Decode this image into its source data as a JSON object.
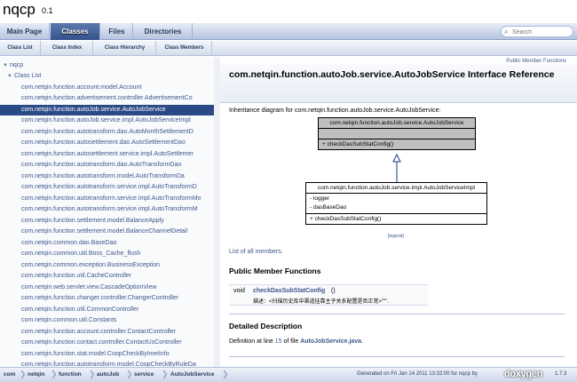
{
  "project": {
    "name": "nqcp",
    "number": "0.1"
  },
  "tabs": [
    "Main Page",
    "Classes",
    "Files",
    "Directories"
  ],
  "search": {
    "placeholder": "Search"
  },
  "subtabs": [
    "Class List",
    "Class Index",
    "Class Hierarchy",
    "Class Members"
  ],
  "nav": {
    "root": "nqcp",
    "section": "Class List",
    "items": [
      "com.netqin.function.account.model.Account",
      "com.netqin.function.advertisement.controller.AdvertisementCo",
      "com.netqin.function.autoJob.service.AutoJobService",
      "com.netqin.function.autoJob.service.impl.AutoJobServiceImpl",
      "com.netqin.function.autotransform.dao.AutoMonthSettlementD",
      "com.netqin.function.autosettlement.dao.AutoSettlementDao",
      "com.netqin.function.autosettlement.service.impl.AutoSettlemer",
      "com.netqin.function.autotransform.dao.AutoTransformDao",
      "com.netqin.function.autotransform.model.AutoTransformDa",
      "com.netqin.function.autotransform.service.impl.AutoTransformD",
      "com.netqin.function.autotransform.service.impl.AutoTransformMo",
      "com.netqin.function.autotransform.service.impl.AutoTransformM",
      "com.netqin.function.settlement.model.BalanceApply",
      "com.netqin.function.settlement.model.BalanceChannelDetail",
      "com.netqin.common.dao.BaseDao",
      "com.netqin.common.util.Boss_Cache_flush",
      "com.netqin.common.exception.BusinessException",
      "com.netqin.function.util.CacheController",
      "com.netqin.web.servlet.view.CascadeOptionView",
      "com.netqin.function.changer.controller.ChangerController",
      "com.netqin.function.util.CommonController",
      "com.netqin.common.util.Constants",
      "com.netqin.function.account.controller.ContactController",
      "com.netqin.function.contact.controller.ContactUsController",
      "com.netqin.function.stat.model.CoopCheckByImeiInfo",
      "com.netqin.function.autotransform.model.CoopCheckByRuleDa"
    ],
    "selected_index": 2
  },
  "content": {
    "summary_link": "Public Member Functions",
    "title": "com.netqin.function.autoJob.service.AutoJobService Interface Reference",
    "inherit_text": "Inheritance diagram for com.netqin.function.autoJob.service.AutoJobService:",
    "uml_parent": {
      "name": "com.netqin.function.autoJob.service.AutoJobService",
      "method": "+ checkDasSubStatConfig()"
    },
    "uml_child": {
      "name": "com.netqin.function.autoJob.service.impl.AutoJobServiceImpl",
      "attr1": "- logger",
      "attr2": "- dasBaseDao",
      "method": "+ checkDasSubStatConfig()"
    },
    "legend": "[legend]",
    "list_all": "List of all members.",
    "pmf_title": "Public Member Functions",
    "member_type": "void",
    "member_name": "checkDasSubStatConfig",
    "member_args": "()",
    "member_desc": "描述：<扫描历史库中渠道挂靠主子关系配置是否正常>\"\"\".",
    "detailed_title": "Detailed Description",
    "def_prefix": "Definition at line",
    "def_line": "15",
    "def_mid": "of file",
    "def_file": "AutoJobService.java",
    "def_suffix": "."
  },
  "breadcrumb": [
    "com",
    "netqin",
    "function",
    "autoJob",
    "service",
    "AutoJobService"
  ],
  "footer": {
    "generated": "Generated on Fri Jan 14 2011 13:32:00 for nqcp by",
    "logo": "doxygen",
    "version": "1.7.3"
  }
}
